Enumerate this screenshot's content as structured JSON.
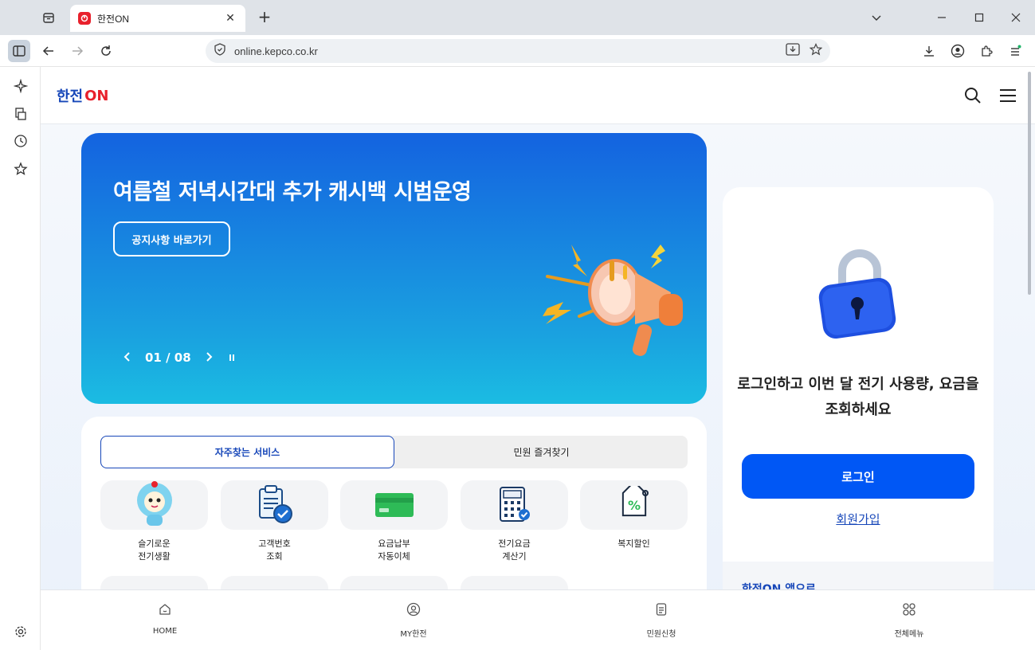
{
  "browser": {
    "tab_title": "한전ON",
    "tab_close": "✕",
    "new_tab": "+",
    "url": "online.kepco.co.kr"
  },
  "site": {
    "logo_text": "한전",
    "logo_suffix": "ON"
  },
  "banner": {
    "title": "여름철 저녁시간대 추가 캐시백 시범운영",
    "button_label": "공지사항 바로가기",
    "counter": "01 / 08"
  },
  "services": {
    "tabs": [
      {
        "label": "자주찾는 서비스"
      },
      {
        "label": "민원 즐겨찾기"
      }
    ],
    "items": [
      {
        "line1": "슬기로운",
        "line2": "전기생활"
      },
      {
        "line1": "고객번호",
        "line2": "조회"
      },
      {
        "line1": "요금납부",
        "line2": "자동이체"
      },
      {
        "line1": "전기요금",
        "line2": "계산기"
      },
      {
        "line1": "복지할인",
        "line2": ""
      }
    ]
  },
  "login": {
    "message_line1": "로그인하고 이번 달 전기 사용량, 요금을",
    "message_line2": "조회하세요",
    "button_label": "로그인",
    "signup_label": "회원가입",
    "app_text": "한전ON 앱으로"
  },
  "bottom_nav": [
    {
      "label": "HOME"
    },
    {
      "label": "MY한전"
    },
    {
      "label": "민원신청"
    },
    {
      "label": "전체메뉴"
    }
  ],
  "colors": {
    "brand_blue": "#1747b9",
    "login_blue": "#0057f5",
    "brand_red": "#e8212c"
  }
}
